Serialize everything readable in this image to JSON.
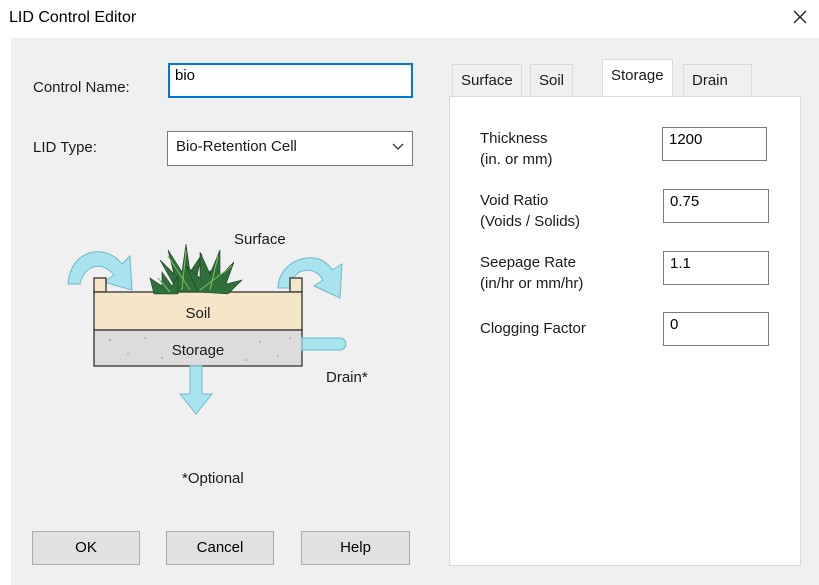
{
  "window": {
    "title": "LID Control Editor"
  },
  "form": {
    "control_name_label": "Control Name:",
    "control_name_value": "bio",
    "lid_type_label": "LID Type:",
    "lid_type_value": "Bio-Retention Cell"
  },
  "diagram": {
    "surface_label": "Surface",
    "soil_label": "Soil",
    "storage_label": "Storage",
    "drain_label": "Drain*",
    "optional_note": "*Optional"
  },
  "buttons": {
    "ok": "OK",
    "cancel": "Cancel",
    "help": "Help"
  },
  "tabs": [
    {
      "label": "Surface",
      "active": false
    },
    {
      "label": "Soil",
      "active": false
    },
    {
      "label": "Storage",
      "active": true
    },
    {
      "label": "Drain",
      "active": false
    }
  ],
  "storage": {
    "fields": [
      {
        "label1": "Thickness",
        "label2": "(in. or mm)",
        "value": "1200"
      },
      {
        "label1": "Void Ratio",
        "label2": "(Voids / Solids)",
        "value": "0.75"
      },
      {
        "label1": "Seepage Rate",
        "label2": "(in/hr or mm/hr)",
        "value": "1.1"
      },
      {
        "label1": "Clogging Factor",
        "label2": "",
        "value": "0"
      }
    ]
  },
  "colors": {
    "accent": "#0078d7",
    "soil_fill": "#f5e6c8",
    "storage_fill": "#dcdcdc",
    "water_arrow": "#a8e3ef",
    "plant_green": "#2f6f3a"
  }
}
